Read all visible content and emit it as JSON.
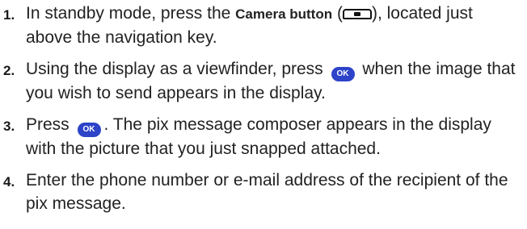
{
  "steps": [
    {
      "number": "1.",
      "before": "In standby mode, press the ",
      "bold": "Camera button",
      "open_paren": " (",
      "after": "), located just above the navigation key.",
      "icon": "camera-key-icon"
    },
    {
      "number": "2.",
      "before": "Using the display as a viewfinder, press ",
      "key_label": "OK",
      "after": " when the image that you wish to send appears in the display.",
      "icon": "ok-key-icon"
    },
    {
      "number": "3.",
      "before": "Press ",
      "key_label": "OK",
      "after": ". The pix message composer appears in the display with the picture that you just snapped attached.",
      "icon": "ok-key-icon"
    },
    {
      "number": "4.",
      "text": "Enter the phone number or e-mail address of the recipient of the pix message."
    }
  ],
  "colors": {
    "ok_key": "#2d43c8",
    "text": "#222222"
  }
}
